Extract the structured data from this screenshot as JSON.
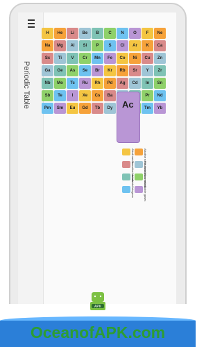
{
  "app": {
    "title": "Periodic Table"
  },
  "table": {
    "featured_symbol": "Ac",
    "rows": [
      [
        "H",
        "He",
        "Li",
        "Be",
        "B",
        "C",
        "N",
        "O",
        "F",
        "Ne"
      ],
      [
        "Na",
        "Mg",
        "Al",
        "Si",
        "P",
        "S",
        "Cl",
        "Ar",
        "K",
        "Ca"
      ],
      [
        "Sc",
        "Ti",
        "V",
        "Cr",
        "Mn",
        "Fe",
        "Co",
        "Ni",
        "Cu",
        "Zn"
      ],
      [
        "Ga",
        "Ge",
        "As",
        "Se",
        "Br",
        "Kr",
        "Rb",
        "Sr",
        "Y",
        "Zr"
      ],
      [
        "Nb",
        "Mo",
        "Tc",
        "Ru",
        "Rh",
        "Pd",
        "Ag",
        "Cd",
        "In",
        "Sn"
      ],
      [
        "Sb",
        "Te",
        "I",
        "Xe",
        "Cs",
        "Ba",
        "La",
        "Ce",
        "Pr",
        "Nd"
      ],
      [
        "Pm",
        "Sm",
        "Eu",
        "Gd",
        "Tb",
        "Dy",
        "Ho",
        "Er",
        "Tm",
        "Yb"
      ]
    ]
  },
  "legend": {
    "items": [
      {
        "label": "Alkali metals",
        "color": "#f4c542"
      },
      {
        "label": "Alkaline earth metals",
        "color": "#f6a23a"
      },
      {
        "label": "Transition metals",
        "color": "#d98a8a"
      },
      {
        "label": "Post-transition metals",
        "color": "#9fc5d6"
      },
      {
        "label": "Metalloids",
        "color": "#7fc3b5"
      },
      {
        "label": "Nonmetals",
        "color": "#8fd16a"
      },
      {
        "label": "Halogens",
        "color": "#6ec2f0"
      },
      {
        "label": "Noble gases",
        "color": "#b996d5"
      }
    ]
  },
  "footer": {
    "brand": "OceanofAPK.com",
    "logo_text": "APK"
  }
}
